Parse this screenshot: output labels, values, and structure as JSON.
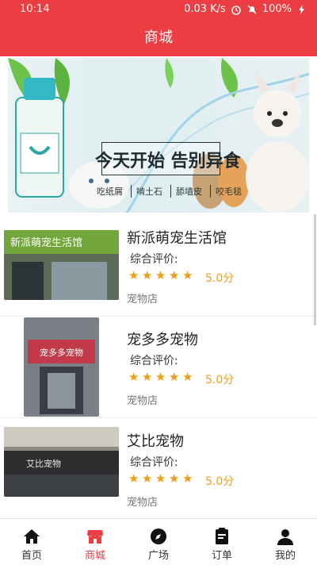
{
  "status_bar": {
    "time": "10:14",
    "network_speed": "0.03 K/s",
    "battery": "100%"
  },
  "header": {
    "title": "商城"
  },
  "banner": {
    "headline": "今天开始 告别异食",
    "tags": [
      "吃纸屑",
      "啃土石",
      "舔墙皮",
      "咬毛毯"
    ]
  },
  "shops": [
    {
      "name": "新派萌宠生活馆",
      "rating_label": "综合评价:",
      "stars": 5,
      "score": "5.0分",
      "category": "宠物店"
    },
    {
      "name": "宠多多宠物",
      "rating_label": "综合评价:",
      "stars": 5,
      "score": "5.0分",
      "category": "宠物店"
    },
    {
      "name": "艾比宠物",
      "rating_label": "综合评价:",
      "stars": 5,
      "score": "5.0分",
      "category": "宠物店"
    }
  ],
  "tabs": [
    {
      "label": "首页",
      "icon": "home-icon"
    },
    {
      "label": "商城",
      "icon": "store-icon",
      "active": true
    },
    {
      "label": "广场",
      "icon": "compass-icon"
    },
    {
      "label": "订单",
      "icon": "order-icon"
    },
    {
      "label": "我的",
      "icon": "user-icon"
    }
  ],
  "colors": {
    "primary": "#ec3d43",
    "star": "#f39c12"
  }
}
